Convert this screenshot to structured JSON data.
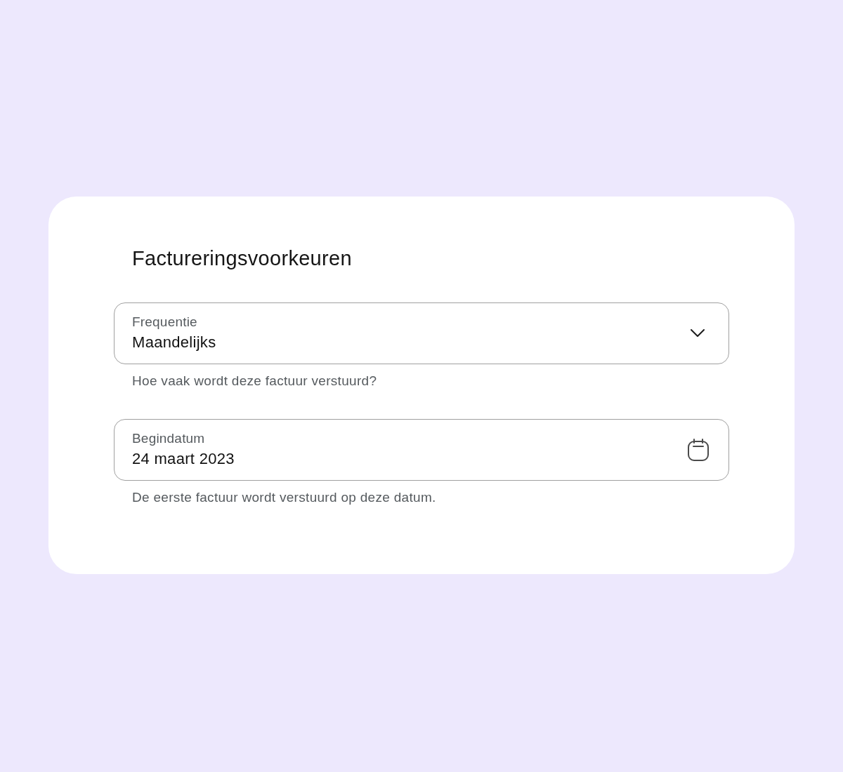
{
  "card": {
    "title": "Factureringsvoorkeuren",
    "fields": [
      {
        "kind": "select",
        "label": "Frequentie",
        "value": "Maandelijks",
        "helper": "Hoe vaak wordt deze factuur verstuurd?"
      },
      {
        "kind": "date",
        "label": "Begindatum",
        "value": "24 maart 2023",
        "helper": "De eerste factuur wordt verstuurd op deze datum."
      }
    ]
  }
}
